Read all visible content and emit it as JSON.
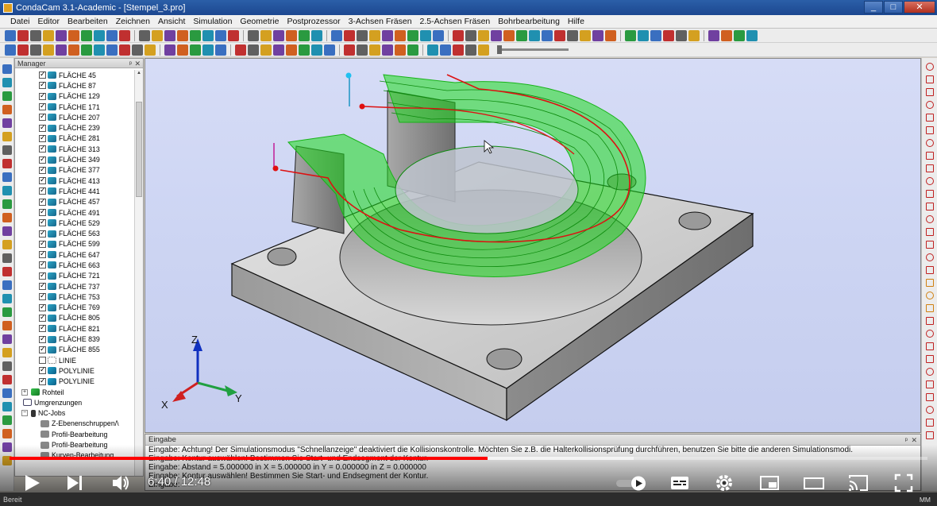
{
  "window": {
    "title": "CondaCam 3.1-Academic - [Stempel_3.pro]",
    "buttons": [
      "_",
      "□",
      "✕"
    ]
  },
  "menu": [
    "Datei",
    "Editor",
    "Bearbeiten",
    "Zeichnen",
    "Ansicht",
    "Simulation",
    "Geometrie",
    "Postprozessor",
    "3-Achsen Fräsen",
    "2.5-Achsen Fräsen",
    "Bohrbearbeitung",
    "Hilfe"
  ],
  "manager": {
    "title": "Manager",
    "pin": "ᵖ",
    "close": "✕",
    "tree": [
      {
        "label": "FLÄCHE 45",
        "type": "face",
        "checked": true
      },
      {
        "label": "FLÄCHE 87",
        "type": "face",
        "checked": true
      },
      {
        "label": "FLÄCHE 129",
        "type": "face",
        "checked": true
      },
      {
        "label": "FLÄCHE 171",
        "type": "face",
        "checked": true
      },
      {
        "label": "FLÄCHE 207",
        "type": "face",
        "checked": true
      },
      {
        "label": "FLÄCHE 239",
        "type": "face",
        "checked": true
      },
      {
        "label": "FLÄCHE 281",
        "type": "face",
        "checked": true
      },
      {
        "label": "FLÄCHE 313",
        "type": "face",
        "checked": true
      },
      {
        "label": "FLÄCHE 349",
        "type": "face",
        "checked": true
      },
      {
        "label": "FLÄCHE 377",
        "type": "face",
        "checked": true
      },
      {
        "label": "FLÄCHE 413",
        "type": "face",
        "checked": true
      },
      {
        "label": "FLÄCHE 441",
        "type": "face",
        "checked": true
      },
      {
        "label": "FLÄCHE 457",
        "type": "face",
        "checked": true
      },
      {
        "label": "FLÄCHE 491",
        "type": "face",
        "checked": true
      },
      {
        "label": "FLÄCHE 529",
        "type": "face",
        "checked": true
      },
      {
        "label": "FLÄCHE 563",
        "type": "face",
        "checked": true
      },
      {
        "label": "FLÄCHE 599",
        "type": "face",
        "checked": true
      },
      {
        "label": "FLÄCHE 647",
        "type": "face",
        "checked": true
      },
      {
        "label": "FLÄCHE 663",
        "type": "face",
        "checked": true
      },
      {
        "label": "FLÄCHE 721",
        "type": "face",
        "checked": true
      },
      {
        "label": "FLÄCHE 737",
        "type": "face",
        "checked": true
      },
      {
        "label": "FLÄCHE 753",
        "type": "face",
        "checked": true
      },
      {
        "label": "FLÄCHE 769",
        "type": "face",
        "checked": true
      },
      {
        "label": "FLÄCHE 805",
        "type": "face",
        "checked": true
      },
      {
        "label": "FLÄCHE 821",
        "type": "face",
        "checked": true
      },
      {
        "label": "FLÄCHE 839",
        "type": "face",
        "checked": true
      },
      {
        "label": "FLÄCHE 855",
        "type": "face",
        "checked": true
      },
      {
        "label": "LINIE",
        "type": "line",
        "checked": false
      },
      {
        "label": "POLYLINIE",
        "type": "poly",
        "checked": true
      },
      {
        "label": "POLYLINIE",
        "type": "poly",
        "checked": true
      },
      {
        "label": "Rohteil",
        "type": "roh",
        "checked": null
      },
      {
        "label": "Umgrenzungen",
        "type": "umg",
        "checked": null
      },
      {
        "label": "NC-Jobs",
        "type": "nc",
        "checked": null
      },
      {
        "label": "Z-Ebenenschruppen/\\",
        "type": "job",
        "checked": null
      },
      {
        "label": "Profil-Bearbeitung",
        "type": "job",
        "checked": null
      },
      {
        "label": "Profil-Bearbeitung",
        "type": "job",
        "checked": null
      },
      {
        "label": "Kurven-Bearbeitung",
        "type": "job",
        "checked": null
      }
    ]
  },
  "viewport": {
    "axes": {
      "z": "Z",
      "y": "Y",
      "x": "X"
    }
  },
  "eingabe": {
    "title": "Eingabe",
    "lines": [
      "Eingabe: Achtung! Der Simulationsmodus \"Schnellanzeige\" deaktiviert die Kollisionskontrolle. Möchten Sie z.B. die Halterkollisionsprüfung durchführen, benutzen Sie bitte die anderen Simulationsmodi.",
      "Eingabe: Kontur auswählen! Bestimmen Sie Start- und Endsegment der Kontur.",
      "Eingabe: Abstand =  5.000000     in X = 5.000000 in Y = 0.000000 in Z = 0.000000",
      "Eingabe: Kontur auswählen! Bestimmen Sie Start- und Endsegment der Kontur.",
      "Eingabe:"
    ]
  },
  "statusbar": {
    "left": "Bereit",
    "right": "MM"
  },
  "video": {
    "time": "6:40 / 12:48",
    "played_fraction": 0.521,
    "buffered_fraction": 0.68,
    "controls": [
      "play-button",
      "next-button",
      "volume-button",
      "autoplay-toggle",
      "subtitles-button",
      "settings-button",
      "miniplayer-button",
      "theater-button",
      "cast-button",
      "fullscreen-button"
    ]
  },
  "colors": {
    "toolpath": "#22dd22",
    "contour": "#dd1111",
    "part_top": "#cfcfcf",
    "part_side": "#8a8a8a",
    "background": "#d0d8f4",
    "progress": "#ff0000"
  }
}
